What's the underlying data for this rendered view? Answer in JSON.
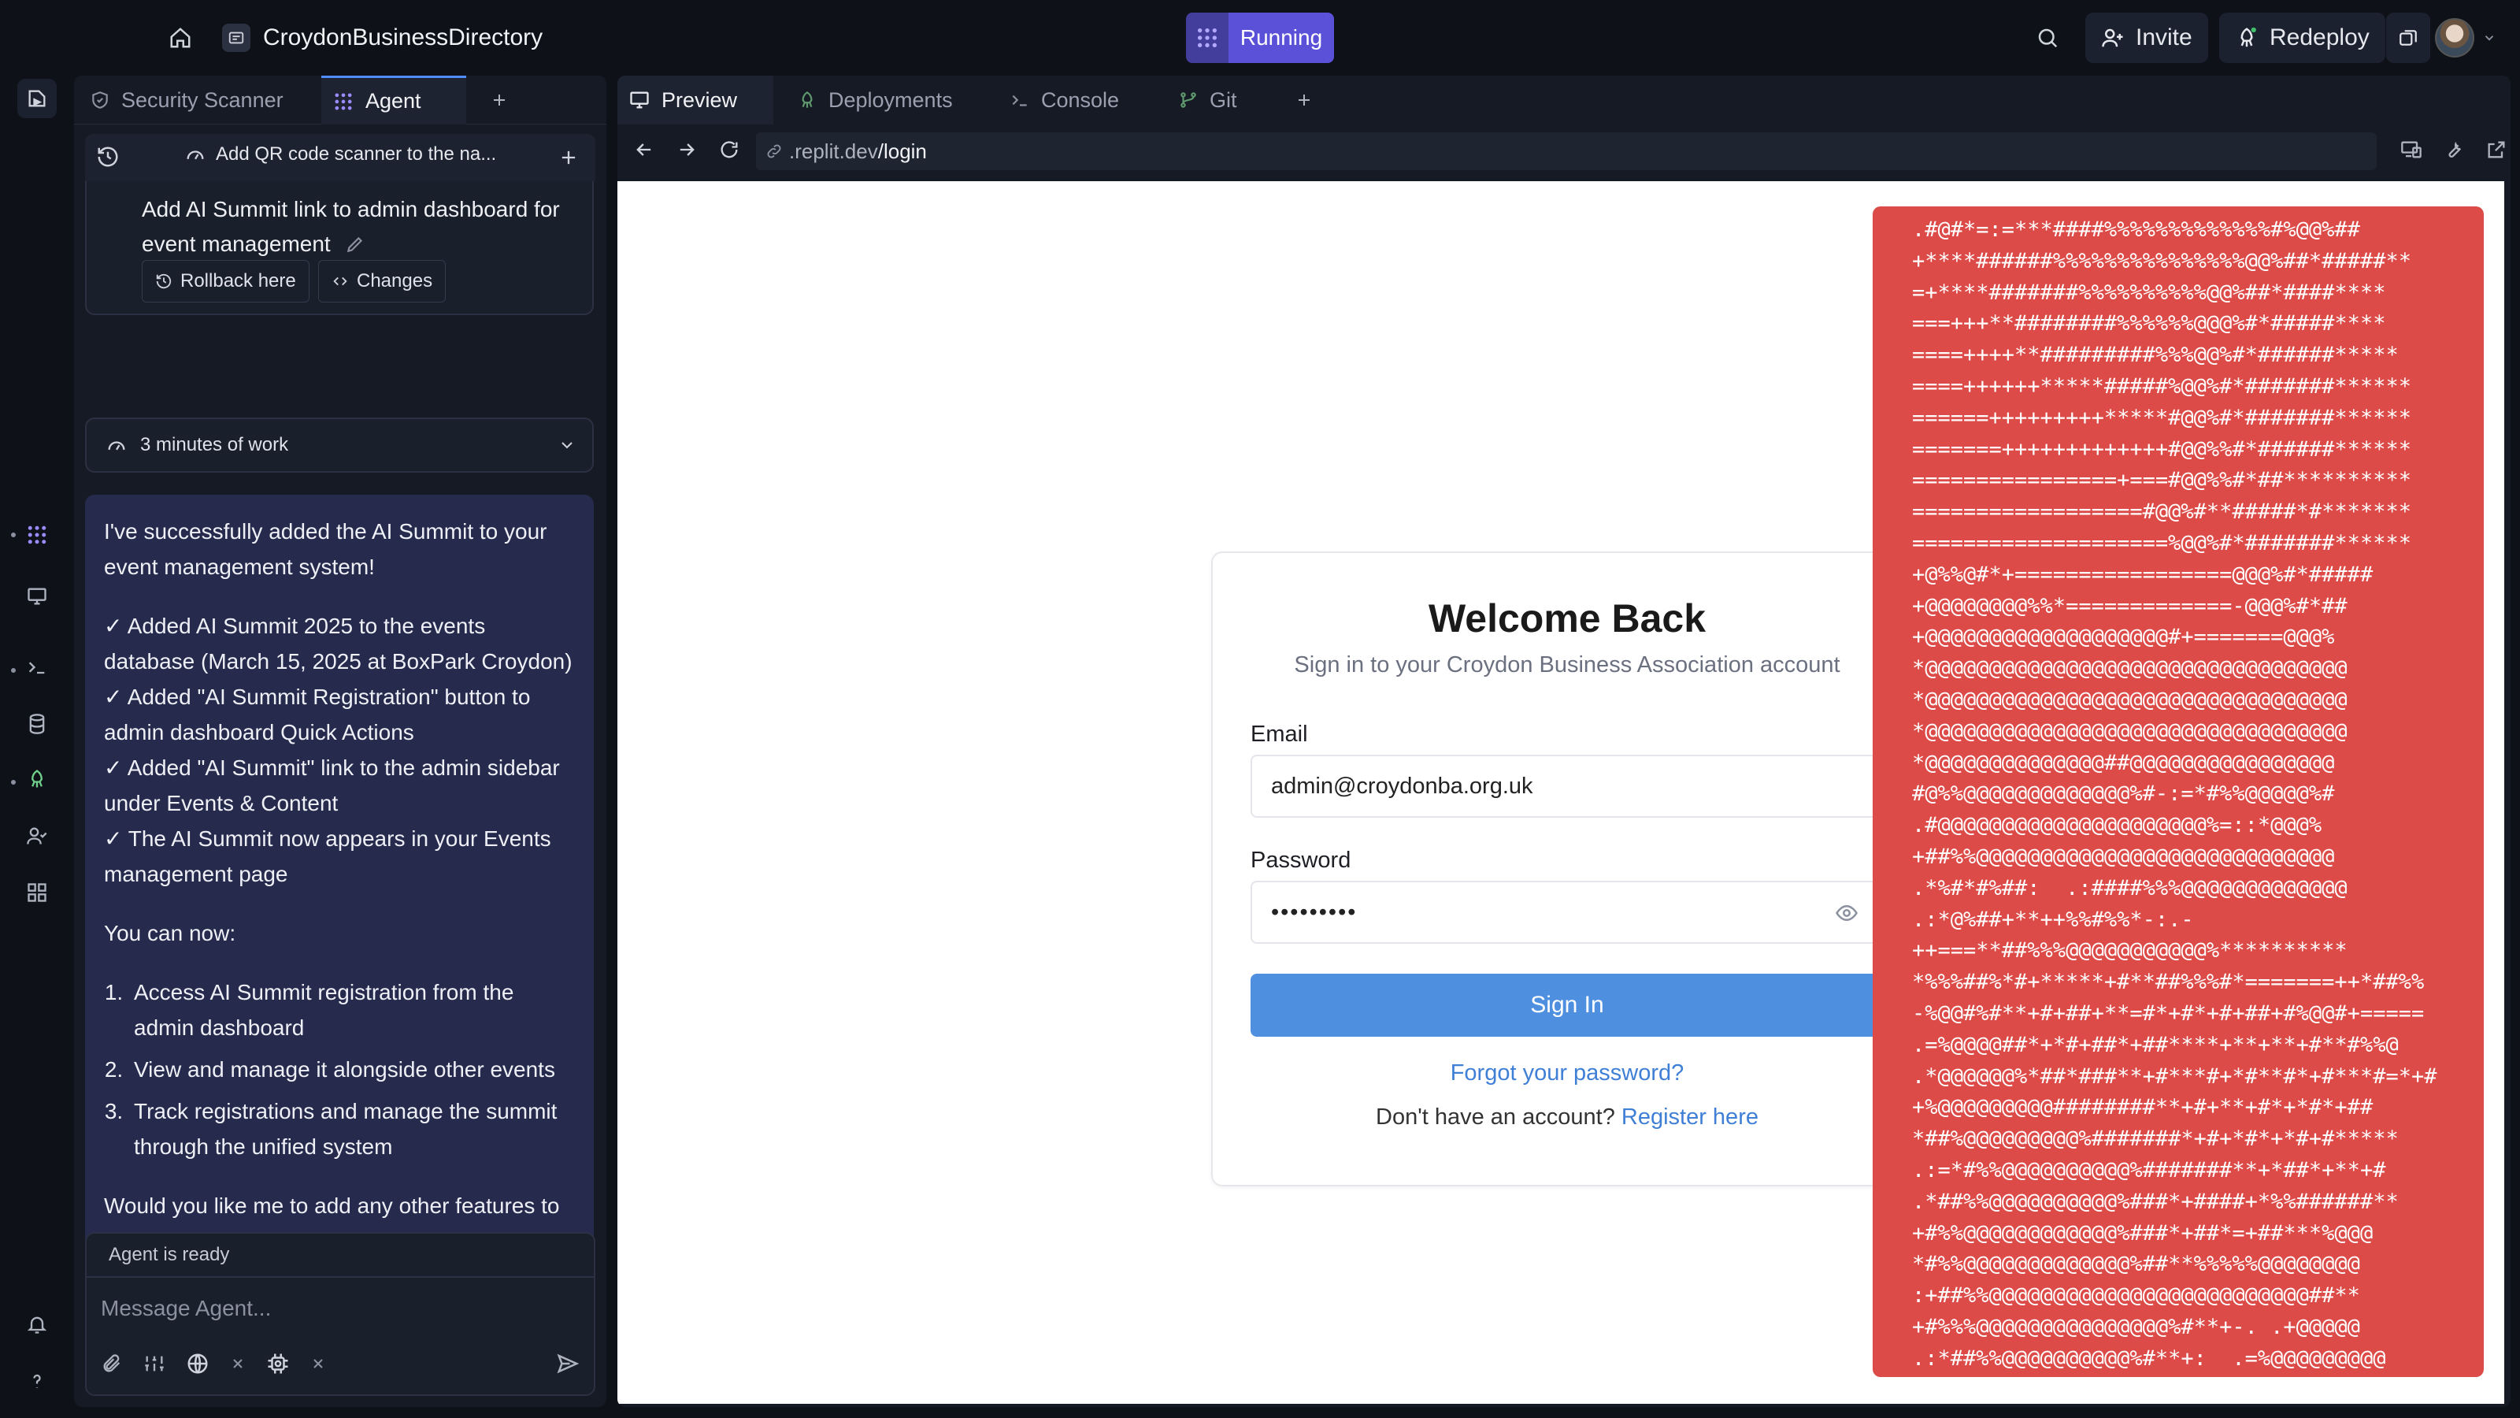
{
  "topbar": {
    "repl_title": "CroydonBusinessDirectory",
    "run_label": "Running",
    "invite_label": "Invite",
    "redeploy_label": "Redeploy"
  },
  "left_tabs": {
    "security_scanner": "Security Scanner",
    "agent": "Agent"
  },
  "agent_toolbar": {
    "task_title": "Add QR code scanner to the na..."
  },
  "message": {
    "text": "Add AI Summit link to admin dashboard for event management",
    "rollback_label": "Rollback here",
    "changes_label": "Changes"
  },
  "work_summary": {
    "label": "3 minutes of work"
  },
  "reply": {
    "intro": "I've successfully added the AI Summit to your event management system!",
    "checks": [
      "✓ Added AI Summit 2025 to the events database (March 15, 2025 at BoxPark Croydon)",
      "✓ Added \"AI Summit Registration\" button to admin dashboard Quick Actions",
      "✓ Added \"AI Summit\" link to the admin sidebar under Events & Content",
      "✓ The AI Summit now appears in your Events management page"
    ],
    "you_can_now": "You can now:",
    "steps": [
      "Access AI Summit registration from the admin dashboard",
      "View and manage it alongside other events",
      "Track registrations and manage the summit through the unified system"
    ],
    "closing": "Would you like me to add any other features to the AI Summit management?"
  },
  "input": {
    "status": "Agent is ready",
    "placeholder": "Message Agent..."
  },
  "right_tabs": {
    "preview": "Preview",
    "deployments": "Deployments",
    "console": "Console",
    "git": "Git"
  },
  "address": {
    "url_prefix": ".replit.dev",
    "url_path": "/login"
  },
  "login": {
    "title": "Welcome Back",
    "subtitle": "Sign in to your Croydon Business Association account",
    "email_label": "Email",
    "email_value": "admin@croydonba.org.uk",
    "password_label": "Password",
    "password_value": "•••••••••",
    "sign_in_label": "Sign In",
    "forgot_label": "Forgot your password?",
    "no_account_text": "Don't have an account?",
    "register_label": "Register here"
  },
  "ascii_art": [
    ".#@#*=:=***####%%%%%%%%%%%%%#%@@%##",
    "+****######%%%%%%%%%%%%%%%@@%##*#####**",
    "=+****#######%%%%%%%%%%@@%##*####****",
    "===+++**########%%%%%%@@@%#*#####****",
    "====++++**#########%%%@@%#*######*****",
    "====++++++*****#####%@@%#*#######******",
    "======+++++++++*****#@@%#*#######******",
    "=======+++++++++++++#@@%%#*######******",
    "================+===#@@%%#*##**********",
    "==================#@@%#**#####*#*******",
    "====================%@@%#*#######******",
    "+@%%@#*+=================@@@%#*#####",
    "+@@@@@@@@%%*=============-@@@%#*##",
    "+@@@@@@@@@@@@@@@@@@@#+=======@@@%",
    "*@@@@@@@@@@@@@@@@@@@@@@@@@@@@@@@@@",
    "*@@@@@@@@@@@@@@@@@@@@@@@@@@@@@@@@@",
    "*@@@@@@@@@@@@@@@@@@@@@@@@@@@@@@@@@",
    "*@@@@@@@@@@@@@@##@@@@@@@@@@@@@@@@",
    "#@%%@@@@@@@@@@@@@%#-:=*#%%@@@@@%#",
    ".#@@@@@@@@@@@@@@@@@@@@@%=::*@@@%",
    "+##%%@@@@@@@@@@@@@@@@@@@@@@@@@@@@",
    ".*%#*#%##:  .:####%%%@@@@@@@@@@@@@",
    ".:*@%##+**++%%#%%*-:.-",
    "++===**##%%%@@@@@@@@@@@%**********",
    "*%%%##%*#+*****+#**##%%%#*=======++*##%%",
    "-%@@#%#**+#+##+**=#*+#*+#+##+#%@@#+=====",
    ".=%@@@@##*+*#+##*+##****+**+**+#**#%%@",
    ".*@@@@@@%*##*###**+#***#+*#**#*+#***#=*+#",
    "+%@@@@@@@@@########**+#+**+#*+*#*+##",
    "*##%@@@@@@@@@%#######*+#+*#*+*#+#*****",
    ".:=*#%%@@@@@@@@@@%#######**+*##*+**+#",
    ".*##%%@@@@@@@@@@%###*+####+*%%######**",
    "+#%%@@@@@@@@@@@@%###*+##*=+##***%@@@",
    "*#%%@@@@@@@@@@@@@%##**%%%%%@@@@@@@@",
    ":+##%%@@@@@@@@@@@@@@@@@@@@@@@@@##**",
    "+#%%%@@@@@@@@@@@@@@@%#**+-. .+@@@@@",
    ".:*##%%@@@@@@@@@@%#**+:  .=%@@@@@@@@@"
  ]
}
